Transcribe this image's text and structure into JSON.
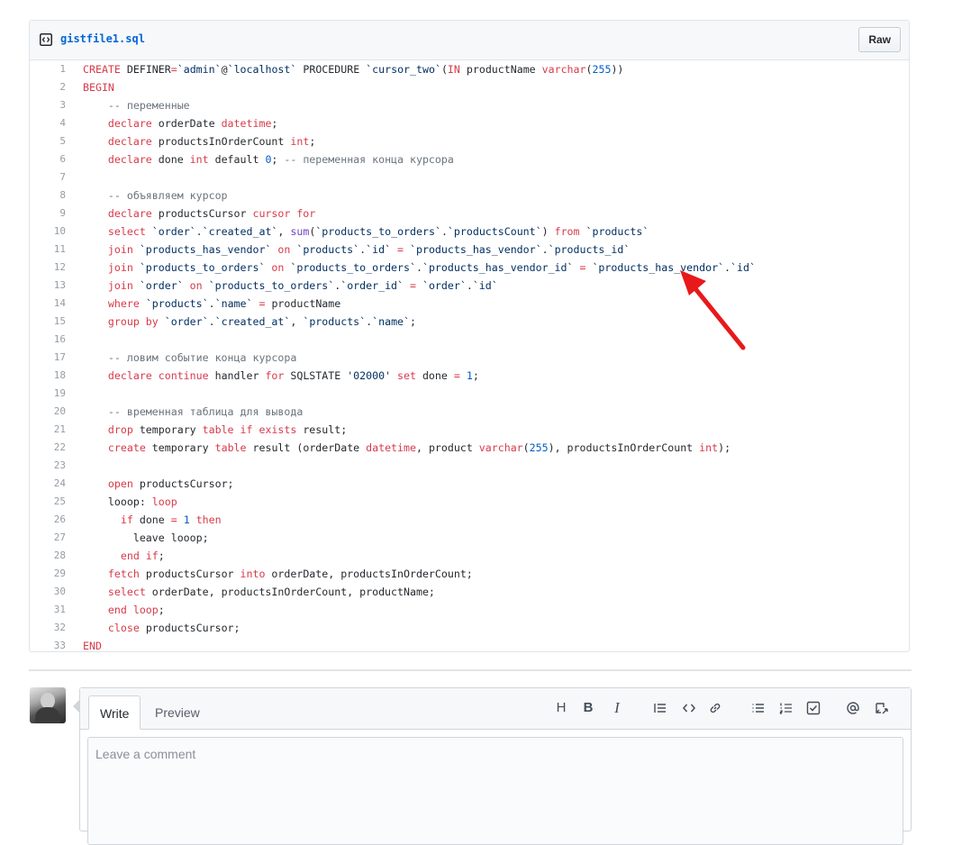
{
  "file": {
    "name": "gistfile1.sql",
    "raw_label": "Raw"
  },
  "code_lines": [
    {
      "n": "1",
      "t": [
        [
          "k",
          "CREATE "
        ],
        [
          "",
          "DEFINER"
        ],
        [
          "k",
          "="
        ],
        [
          "s",
          "`admin`"
        ],
        [
          "",
          "@"
        ],
        [
          "s",
          "`localhost` "
        ],
        [
          "",
          "PROCEDURE "
        ],
        [
          "s",
          "`cursor_two`"
        ],
        [
          "",
          "("
        ],
        [
          "k",
          "IN "
        ],
        [
          "",
          "productName "
        ],
        [
          "k",
          "varchar"
        ],
        [
          "",
          "("
        ],
        [
          "n",
          "255"
        ],
        [
          "",
          "))"
        ]
      ]
    },
    {
      "n": "2",
      "t": [
        [
          "k",
          "BEGIN"
        ]
      ]
    },
    {
      "n": "3",
      "t": [
        [
          "c",
          "    -- переменные"
        ]
      ]
    },
    {
      "n": "4",
      "t": [
        [
          "",
          "    "
        ],
        [
          "k",
          "declare "
        ],
        [
          "",
          "orderDate "
        ],
        [
          "k",
          "datetime"
        ],
        [
          "",
          ";"
        ]
      ]
    },
    {
      "n": "5",
      "t": [
        [
          "",
          "    "
        ],
        [
          "k",
          "declare "
        ],
        [
          "",
          "productsInOrderCount "
        ],
        [
          "k",
          "int"
        ],
        [
          "",
          ";"
        ]
      ]
    },
    {
      "n": "6",
      "t": [
        [
          "",
          "    "
        ],
        [
          "k",
          "declare "
        ],
        [
          "",
          "done "
        ],
        [
          "k",
          "int "
        ],
        [
          "",
          "default "
        ],
        [
          "n",
          "0"
        ],
        [
          "",
          "; "
        ],
        [
          "c",
          "-- переменная конца курсора"
        ]
      ]
    },
    {
      "n": "7",
      "t": [
        [
          "",
          ""
        ]
      ]
    },
    {
      "n": "8",
      "t": [
        [
          "c",
          "    -- объявляем курсор"
        ]
      ]
    },
    {
      "n": "9",
      "t": [
        [
          "",
          "    "
        ],
        [
          "k",
          "declare "
        ],
        [
          "",
          "productsCursor "
        ],
        [
          "k",
          "cursor for"
        ]
      ]
    },
    {
      "n": "10",
      "t": [
        [
          "",
          "    "
        ],
        [
          "k",
          "select "
        ],
        [
          "s",
          "`order`"
        ],
        [
          "",
          "."
        ],
        [
          "s",
          "`created_at`"
        ],
        [
          "",
          ", "
        ],
        [
          "f",
          "sum"
        ],
        [
          "",
          "("
        ],
        [
          "s",
          "`products_to_orders`"
        ],
        [
          "",
          "."
        ],
        [
          "s",
          "`productsCount`"
        ],
        [
          "",
          ") "
        ],
        [
          "k",
          "from "
        ],
        [
          "s",
          "`products`"
        ]
      ]
    },
    {
      "n": "11",
      "t": [
        [
          "",
          "    "
        ],
        [
          "k",
          "join "
        ],
        [
          "s",
          "`products_has_vendor` "
        ],
        [
          "k",
          "on "
        ],
        [
          "s",
          "`products`"
        ],
        [
          "",
          "."
        ],
        [
          "s",
          "`id` "
        ],
        [
          "k",
          "= "
        ],
        [
          "s",
          "`products_has_vendor`"
        ],
        [
          "",
          "."
        ],
        [
          "s",
          "`products_id`"
        ]
      ]
    },
    {
      "n": "12",
      "t": [
        [
          "",
          "    "
        ],
        [
          "k",
          "join "
        ],
        [
          "s",
          "`products_to_orders` "
        ],
        [
          "k",
          "on "
        ],
        [
          "s",
          "`products_to_orders`"
        ],
        [
          "",
          "."
        ],
        [
          "s",
          "`products_has_vendor_id` "
        ],
        [
          "k",
          "= "
        ],
        [
          "s",
          "`products_has_vendor`"
        ],
        [
          "",
          "."
        ],
        [
          "s",
          "`id`"
        ]
      ]
    },
    {
      "n": "13",
      "t": [
        [
          "",
          "    "
        ],
        [
          "k",
          "join "
        ],
        [
          "s",
          "`order` "
        ],
        [
          "k",
          "on "
        ],
        [
          "s",
          "`products_to_orders`"
        ],
        [
          "",
          "."
        ],
        [
          "s",
          "`order_id` "
        ],
        [
          "k",
          "= "
        ],
        [
          "s",
          "`order`"
        ],
        [
          "",
          "."
        ],
        [
          "s",
          "`id`"
        ]
      ]
    },
    {
      "n": "14",
      "t": [
        [
          "",
          "    "
        ],
        [
          "k",
          "where "
        ],
        [
          "s",
          "`products`"
        ],
        [
          "",
          "."
        ],
        [
          "s",
          "`name` "
        ],
        [
          "k",
          "= "
        ],
        [
          "",
          "productName"
        ]
      ]
    },
    {
      "n": "15",
      "t": [
        [
          "",
          "    "
        ],
        [
          "k",
          "group by "
        ],
        [
          "s",
          "`order`"
        ],
        [
          "",
          "."
        ],
        [
          "s",
          "`created_at`"
        ],
        [
          "",
          ", "
        ],
        [
          "s",
          "`products`"
        ],
        [
          "",
          "."
        ],
        [
          "s",
          "`name`"
        ],
        [
          "",
          ";"
        ]
      ]
    },
    {
      "n": "16",
      "t": [
        [
          "",
          ""
        ]
      ]
    },
    {
      "n": "17",
      "t": [
        [
          "c",
          "    -- ловим событие конца курсора"
        ]
      ]
    },
    {
      "n": "18",
      "t": [
        [
          "",
          "    "
        ],
        [
          "k",
          "declare continue "
        ],
        [
          "",
          "handler "
        ],
        [
          "k",
          "for "
        ],
        [
          "",
          "SQLSTATE "
        ],
        [
          "s",
          "'02000' "
        ],
        [
          "k",
          "set "
        ],
        [
          "",
          "done "
        ],
        [
          "k",
          "= "
        ],
        [
          "n",
          "1"
        ],
        [
          "",
          ";"
        ]
      ]
    },
    {
      "n": "19",
      "t": [
        [
          "",
          ""
        ]
      ]
    },
    {
      "n": "20",
      "t": [
        [
          "c",
          "    -- временная таблица для вывода"
        ]
      ]
    },
    {
      "n": "21",
      "t": [
        [
          "",
          "    "
        ],
        [
          "k",
          "drop "
        ],
        [
          "",
          "temporary "
        ],
        [
          "k",
          "table if exists "
        ],
        [
          "",
          "result;"
        ]
      ]
    },
    {
      "n": "22",
      "t": [
        [
          "",
          "    "
        ],
        [
          "k",
          "create "
        ],
        [
          "",
          "temporary "
        ],
        [
          "k",
          "table "
        ],
        [
          "",
          "result (orderDate "
        ],
        [
          "k",
          "datetime"
        ],
        [
          "",
          ", product "
        ],
        [
          "k",
          "varchar"
        ],
        [
          "",
          "("
        ],
        [
          "n",
          "255"
        ],
        [
          "",
          "), productsInOrderCount "
        ],
        [
          "k",
          "int"
        ],
        [
          "",
          ");"
        ]
      ]
    },
    {
      "n": "23",
      "t": [
        [
          "",
          ""
        ]
      ]
    },
    {
      "n": "24",
      "t": [
        [
          "",
          "    "
        ],
        [
          "k",
          "open "
        ],
        [
          "",
          "productsCursor;"
        ]
      ]
    },
    {
      "n": "25",
      "t": [
        [
          "",
          "    looop: "
        ],
        [
          "k",
          "loop"
        ]
      ]
    },
    {
      "n": "26",
      "t": [
        [
          "",
          "      "
        ],
        [
          "k",
          "if "
        ],
        [
          "",
          "done "
        ],
        [
          "k",
          "= "
        ],
        [
          "n",
          "1 "
        ],
        [
          "k",
          "then"
        ]
      ]
    },
    {
      "n": "27",
      "t": [
        [
          "",
          "        leave looop;"
        ]
      ]
    },
    {
      "n": "28",
      "t": [
        [
          "",
          "      "
        ],
        [
          "k",
          "end if"
        ],
        [
          "",
          ";"
        ]
      ]
    },
    {
      "n": "29",
      "t": [
        [
          "",
          "    "
        ],
        [
          "k",
          "fetch "
        ],
        [
          "",
          "productsCursor "
        ],
        [
          "k",
          "into "
        ],
        [
          "",
          "orderDate, productsInOrderCount;"
        ]
      ]
    },
    {
      "n": "30",
      "t": [
        [
          "",
          "    "
        ],
        [
          "k",
          "select "
        ],
        [
          "",
          "orderDate, productsInOrderCount, productName;"
        ]
      ]
    },
    {
      "n": "31",
      "t": [
        [
          "",
          "    "
        ],
        [
          "k",
          "end loop"
        ],
        [
          "",
          ";"
        ]
      ]
    },
    {
      "n": "32",
      "t": [
        [
          "",
          "    "
        ],
        [
          "k",
          "close "
        ],
        [
          "",
          "productsCursor;"
        ]
      ]
    },
    {
      "n": "33",
      "t": [
        [
          "k",
          "END"
        ]
      ]
    }
  ],
  "comment": {
    "tabs": [
      "Write",
      "Preview"
    ],
    "toolbar": [
      "H",
      "B",
      "I"
    ],
    "placeholder": "Leave a comment"
  },
  "colors": {
    "keyword": "#d73a49",
    "comment": "#6a737d",
    "string": "#032f62",
    "number": "#005cc5",
    "arrow": "#e8191b",
    "link": "#0366d6"
  }
}
